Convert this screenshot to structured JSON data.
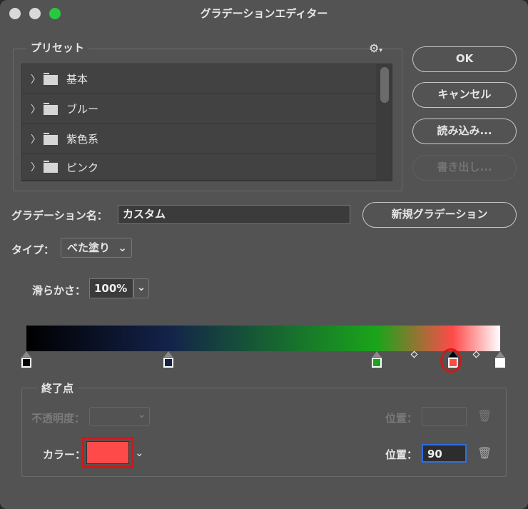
{
  "window": {
    "title": "グラデーションエディター"
  },
  "presets": {
    "legend": "プリセット",
    "gear_icon": "gear-icon",
    "items": [
      {
        "label": "基本"
      },
      {
        "label": "ブルー"
      },
      {
        "label": "紫色系"
      },
      {
        "label": "ピンク"
      }
    ]
  },
  "buttons": {
    "ok": "OK",
    "cancel": "キャンセル",
    "load": "読み込み...",
    "export": "書き出し...",
    "new_gradient": "新規グラデーション"
  },
  "name": {
    "label": "グラデーション名：",
    "value": "カスタム"
  },
  "type": {
    "label": "タイプ：",
    "value": "べた塗り"
  },
  "smoothness": {
    "label": "滑らかさ：",
    "value": "100%"
  },
  "gradient": {
    "stops": [
      {
        "color": "#000000",
        "location": 0
      },
      {
        "color": "#14224a",
        "location": 30
      },
      {
        "color": "#1aa51a",
        "location": 74
      },
      {
        "color": "#ff4a4a",
        "location": 90,
        "selected": true
      },
      {
        "color": "#ffffff",
        "location": 100
      }
    ],
    "midpoints": [
      82,
      95
    ]
  },
  "stop_panel": {
    "legend": "終了点",
    "opacity_label": "不透明度：",
    "opacity_location_label": "位置：",
    "color_label": "カラー：",
    "color_value": "#ff4a4a",
    "color_location_label": "位置：",
    "color_location_value": "90"
  }
}
